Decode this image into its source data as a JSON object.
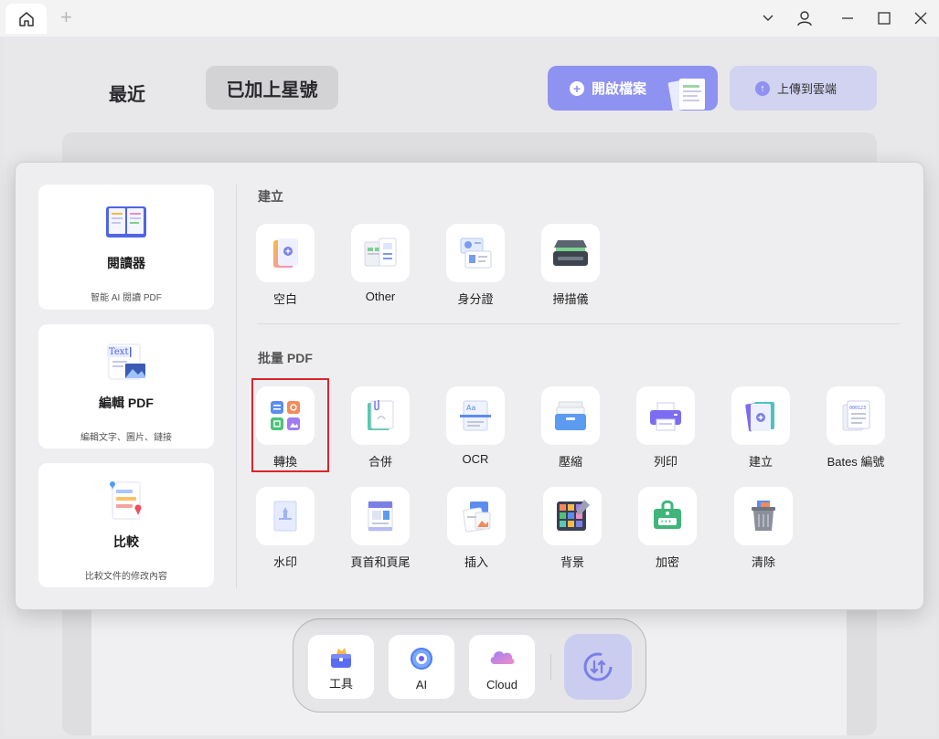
{
  "titlebar": {
    "home_icon": "home-icon",
    "new_tab_symbol": "+"
  },
  "header": {
    "tabs": [
      {
        "label": "最近",
        "active": false
      },
      {
        "label": "已加上星號",
        "active": true
      }
    ],
    "open_file_label": "開啟檔案",
    "upload_label": "上傳到雲端"
  },
  "overlay": {
    "cards": [
      {
        "title": "閱讀器",
        "subtitle": "智能 AI 閱讀 PDF",
        "icon": "book-icon"
      },
      {
        "title": "編輯 PDF",
        "subtitle": "編輯文字、圖片、鏈接",
        "icon": "edit-text-icon"
      },
      {
        "title": "比較",
        "subtitle": "比較文件的修改內容",
        "icon": "compare-icon"
      }
    ],
    "create_section": {
      "title": "建立",
      "items": [
        {
          "label": "空白",
          "icon": "blank-doc-icon"
        },
        {
          "label": "Other",
          "icon": "other-docs-icon"
        },
        {
          "label": "身分證",
          "icon": "id-card-icon"
        },
        {
          "label": "掃描儀",
          "icon": "scanner-icon"
        }
      ]
    },
    "batch_section": {
      "title": "批量 PDF",
      "row1": [
        {
          "label": "轉換",
          "icon": "convert-icon"
        },
        {
          "label": "合併",
          "icon": "merge-icon"
        },
        {
          "label": "OCR",
          "icon": "ocr-icon"
        },
        {
          "label": "壓縮",
          "icon": "compress-icon"
        },
        {
          "label": "列印",
          "icon": "printer-icon"
        },
        {
          "label": "建立",
          "icon": "create-icon"
        },
        {
          "label": "Bates 編號",
          "icon": "bates-icon"
        }
      ],
      "row2": [
        {
          "label": "水印",
          "icon": "watermark-icon"
        },
        {
          "label": "頁首和頁尾",
          "icon": "header-footer-icon"
        },
        {
          "label": "插入",
          "icon": "insert-icon"
        },
        {
          "label": "背景",
          "icon": "background-icon"
        },
        {
          "label": "加密",
          "icon": "lock-icon"
        },
        {
          "label": "清除",
          "icon": "trash-icon"
        }
      ]
    },
    "highlighted_item": "轉換"
  },
  "dock": {
    "items": [
      {
        "label": "工具",
        "icon": "toolbox-icon"
      },
      {
        "label": "AI",
        "icon": "ai-icon"
      },
      {
        "label": "Cloud",
        "icon": "cloud-icon"
      }
    ],
    "action_icon": "sync-icon"
  },
  "colors": {
    "accent": "#8e92f0",
    "highlight": "#d9262b"
  }
}
